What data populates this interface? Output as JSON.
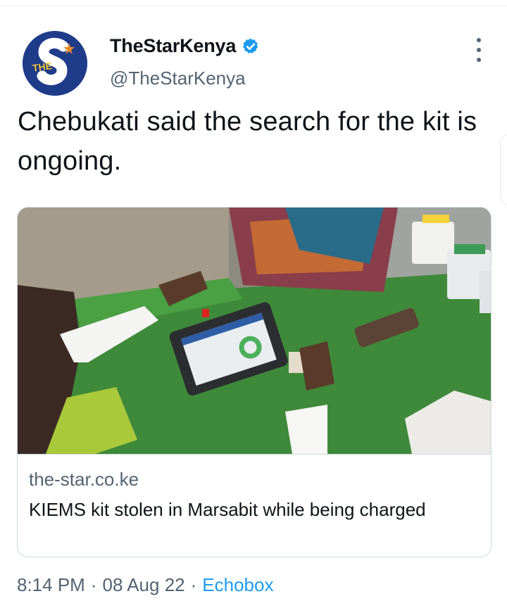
{
  "colors": {
    "accent": "#1d9bf0",
    "muted": "#536471",
    "text": "#0f1419",
    "border": "#cfd9de"
  },
  "author": {
    "display_name": "TheStarKenya",
    "handle": "@TheStarKenya",
    "verified": true,
    "avatar_icon": "the-star-logo",
    "avatar_text": "THE"
  },
  "tweet": {
    "text": "Chebukati said the search for the kit is ongoing."
  },
  "link_card": {
    "image_icon": "photo-kiems-kit",
    "domain": "the-star.co.ke",
    "title": "KIEMS kit stolen in Marsabit while being charged"
  },
  "footer": {
    "time": "8:14 PM",
    "date": "08 Aug 22",
    "separator": "·",
    "source": "Echobox"
  }
}
